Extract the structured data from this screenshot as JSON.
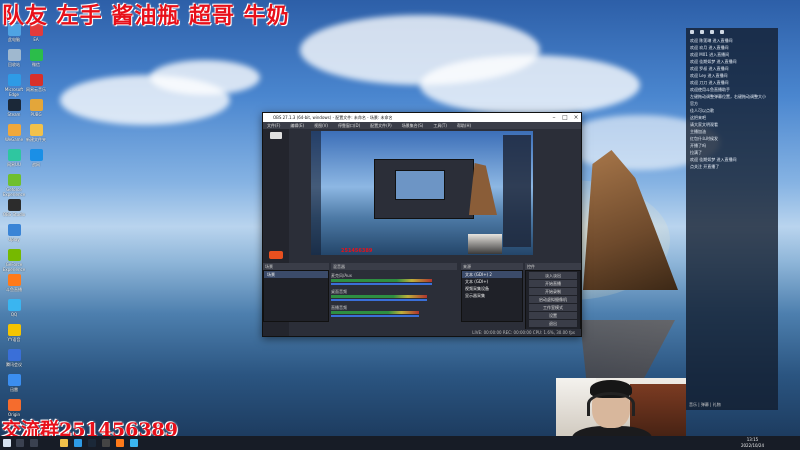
{
  "overlay": {
    "top_names": "队友 左手 酱油瓶 超哥 牛奶",
    "qq_group": "交流群251456389"
  },
  "desktop_icons": [
    {
      "label": "此电脑",
      "color": "#4fa3e3"
    },
    {
      "label": "回收站",
      "color": "#9fb8cf"
    },
    {
      "label": "Microsoft Edge",
      "color": "#2e9be6"
    },
    {
      "label": "Steam",
      "color": "#1b2838"
    },
    {
      "label": "WeGame",
      "color": "#f0a83c"
    },
    {
      "label": "网易UU",
      "color": "#2fc6a0"
    },
    {
      "label": "Geforce Experience",
      "color": "#6fbf2f"
    },
    {
      "label": "OBS Studio",
      "color": "#2c2c2c"
    },
    {
      "label": "Uplay",
      "color": "#3a84d6"
    },
    {
      "label": "GeForce Experience",
      "color": "#76b900"
    },
    {
      "label": "斗鱼直播",
      "color": "#ff7a1a"
    },
    {
      "label": "QQ",
      "color": "#3ab5f0"
    },
    {
      "label": "YY语音",
      "color": "#f5c400"
    },
    {
      "label": "腾讯会议",
      "color": "#3a6fd8"
    },
    {
      "label": "迅雷",
      "color": "#3b8ef0"
    },
    {
      "label": "Origin",
      "color": "#f56c2d"
    },
    {
      "label": "EA",
      "color": "#e33b3b"
    },
    {
      "label": "微信",
      "color": "#2bbd4a"
    },
    {
      "label": "网易云音乐",
      "color": "#d8302a"
    },
    {
      "label": "PUBG",
      "color": "#e3a63a"
    },
    {
      "label": "新建文件夹",
      "color": "#f2c14a"
    },
    {
      "label": "战网",
      "color": "#1a8fe6"
    }
  ],
  "obs": {
    "title": "OBS 27.1.3 (64-bit, windows) - 配置文件: 未命名 - 场景: 未命名",
    "menu": [
      "文件(F)",
      "编辑(E)",
      "视图(V)",
      "停靠窗口(D)",
      "配置文件(P)",
      "场景集合(S)",
      "工具(T)",
      "帮助(H)"
    ],
    "preview_number": "251456389",
    "panels": {
      "scenes": "场景",
      "sources": "来源",
      "mixer": "混音器",
      "transitions": "转场特效",
      "controls": "控件"
    },
    "scene_list": [
      "场景"
    ],
    "mixer_rows": [
      {
        "name": "麦克风/Aux",
        "level": 0.8
      },
      {
        "name": "桌面音频",
        "level": 0.76
      },
      {
        "name": "直播音频",
        "level": 0.7
      }
    ],
    "source_list": [
      "文本 (GDI+) 2",
      "文本 (GDI+)",
      "视频采集设备",
      "显示器采集"
    ],
    "transition_value": "淡入淡出",
    "controls": [
      "开始直播",
      "开始录制",
      "启动虚拟摄像机",
      "工作室模式",
      "设置",
      "退出"
    ],
    "status": "LIVE: 00:00:00   REC: 00:00:00   CPU: 1.6%, 30.00 fps"
  },
  "chat": {
    "lines": [
      "欢迎 陈莲琳 进入直播间",
      "欢迎 玖月 进入直播间",
      "欢迎 M01 进入直播间",
      "欢迎 佳期如梦 进入直播间",
      "欢迎 罗叔 进入直播间",
      "欢迎 Ley 进入直播间",
      "欢迎 刀刀 进入直播间",
      "欢迎使用斗鱼直播助手",
      "左键拖动调整弹幕位置，右键拖动调整大小",
      "官方",
      "佳人可以点歌",
      "这把来吧",
      "请大家文明观看",
      "主播加油",
      "红包什么时候发",
      "开播了吗",
      "拉满了",
      "欢迎 佳期如梦 进入直播间",
      "点关注 开直播了"
    ],
    "bottom": "音乐  |  弹幕  |  礼物"
  },
  "taskbar": {
    "time": "13:15",
    "date": "2022/10/24"
  }
}
